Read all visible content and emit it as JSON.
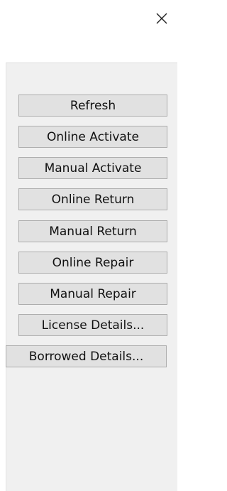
{
  "window": {
    "close_icon": "close-icon"
  },
  "buttons": [
    {
      "label": "Refresh"
    },
    {
      "label": "Online Activate"
    },
    {
      "label": "Manual Activate"
    },
    {
      "label": "Online Return"
    },
    {
      "label": "Manual Return"
    },
    {
      "label": "Online Repair"
    },
    {
      "label": "Manual Repair"
    },
    {
      "label": "License Details..."
    },
    {
      "label": "Borrowed Details..."
    }
  ]
}
